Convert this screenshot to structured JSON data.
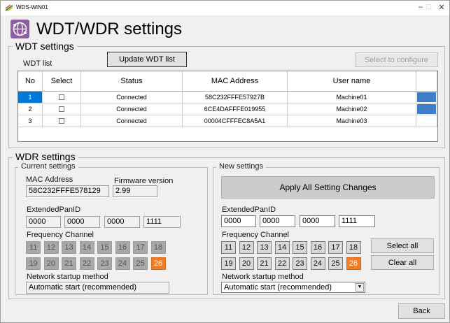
{
  "window": {
    "title": "WDS-WIN01",
    "controls": [
      "–",
      "□",
      "✕"
    ]
  },
  "header": {
    "title": "WDT/WDR settings",
    "icon": "network-globe-icon"
  },
  "wdt": {
    "section_title": "WDT settings",
    "list_label": "WDT list",
    "update_label": "Update WDT list",
    "select_configure_label": "Select to configure",
    "columns": [
      "No",
      "Select",
      "Status",
      "MAC Address",
      "User name"
    ],
    "rows": [
      {
        "no": "1",
        "status": "Connected",
        "mac": "58C232FFFE57927B",
        "user": "Machine01"
      },
      {
        "no": "2",
        "status": "Connected",
        "mac": "6CE4DAFFFE019955",
        "user": "Machine02"
      },
      {
        "no": "3",
        "status": "Connected",
        "mac": "00004CFFFEC8A5A1",
        "user": "Machine03"
      }
    ]
  },
  "wdr": {
    "section_title": "WDR settings",
    "current": {
      "title": "Current settings",
      "mac_label": "MAC Address",
      "mac_value": "58C232FFFE578129",
      "fw_label": "Firmware version",
      "fw_value": "2.99",
      "panid_label": "ExtendedPanID",
      "panid": [
        "0000",
        "0000",
        "0000",
        "1111"
      ],
      "freq_label": "Frequency Channel",
      "channels": [
        "11",
        "12",
        "13",
        "14",
        "15",
        "16",
        "17",
        "18",
        "19",
        "20",
        "21",
        "22",
        "23",
        "24",
        "25",
        "26"
      ],
      "active_channel": "26",
      "startup_label": "Network startup method",
      "startup_value": "Automatic start (recommended)"
    },
    "new": {
      "title": "New settings",
      "apply_label": "Apply All Setting Changes",
      "panid_label": "ExtendedPanID",
      "panid": [
        "0000",
        "0000",
        "0000",
        "1111"
      ],
      "freq_label": "Frequency Channel",
      "channels": [
        "11",
        "12",
        "13",
        "14",
        "15",
        "16",
        "17",
        "18",
        "19",
        "20",
        "21",
        "22",
        "23",
        "24",
        "25",
        "26"
      ],
      "active_channel": "26",
      "select_all_label": "Select all",
      "clear_all_label": "Clear all",
      "startup_label": "Network startup method",
      "startup_value": "Automatic start (recommended)"
    }
  },
  "footer": {
    "back_label": "Back"
  },
  "colors": {
    "accent_orange": "#f07d28",
    "selection_blue": "#0078d7",
    "edit_blue": "#3d7ec9",
    "icon_purple": "#8e5fa0"
  }
}
